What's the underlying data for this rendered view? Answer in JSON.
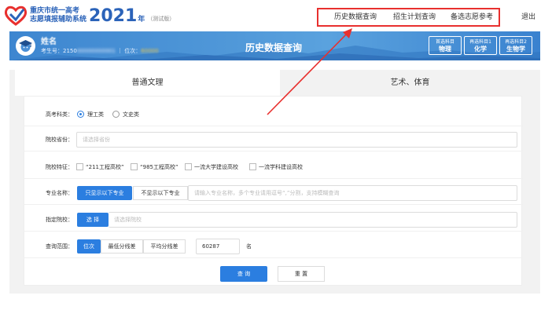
{
  "header": {
    "logo_line1": "重庆市统一高考",
    "logo_line2": "志愿填报辅助系统",
    "year": "2021",
    "year_suffix": "年",
    "edition": "（测试版）",
    "nav": [
      {
        "label": "历史数据查询"
      },
      {
        "label": "招生计划查询"
      },
      {
        "label": "备选志愿参考"
      }
    ],
    "logout": "退出"
  },
  "hero": {
    "user_name": "姓名",
    "info_prefix": "考生号：2150",
    "info_hidden": "00000000001",
    "info_sep": "｜ 位次：",
    "info_rank": "60000",
    "title": "历史数据查询",
    "subjects": [
      {
        "label": "首选科目",
        "value": "物理"
      },
      {
        "label": "再选科目1",
        "value": "化学"
      },
      {
        "label": "再选科目2",
        "value": "生物学"
      }
    ]
  },
  "tabs": [
    {
      "label": "普通文理"
    },
    {
      "label": "艺术、体育"
    }
  ],
  "form": {
    "category": {
      "label": "高考科类：",
      "options": [
        "理工类",
        "文史类"
      ]
    },
    "province": {
      "label": "院校省份：",
      "placeholder": "请选择省份"
    },
    "feature": {
      "label": "院校特征：",
      "options": [
        "“211工程高校”",
        "“985工程高校”",
        "一流大学建设高校",
        "一流学科建设高校"
      ]
    },
    "major": {
      "label": "专业名称：",
      "btn_on": "只显示以下专业",
      "btn_off": "不显示以下专业",
      "placeholder": "请输入专业名称，多个专业请用逗号“,”分割，支持模糊查询"
    },
    "school": {
      "label": "指定院校：",
      "btn": "选 择",
      "placeholder": "请选择院校"
    },
    "range": {
      "label": "查询范围：",
      "modes": [
        "位次",
        "最低分线差",
        "平均分线差"
      ],
      "value": "60287",
      "unit": "名"
    },
    "query": "查 询",
    "reset": "重 置"
  },
  "colors": {
    "accent": "#2b7ee0",
    "brand": "#2b63b9",
    "highlight": "#e8302e"
  }
}
